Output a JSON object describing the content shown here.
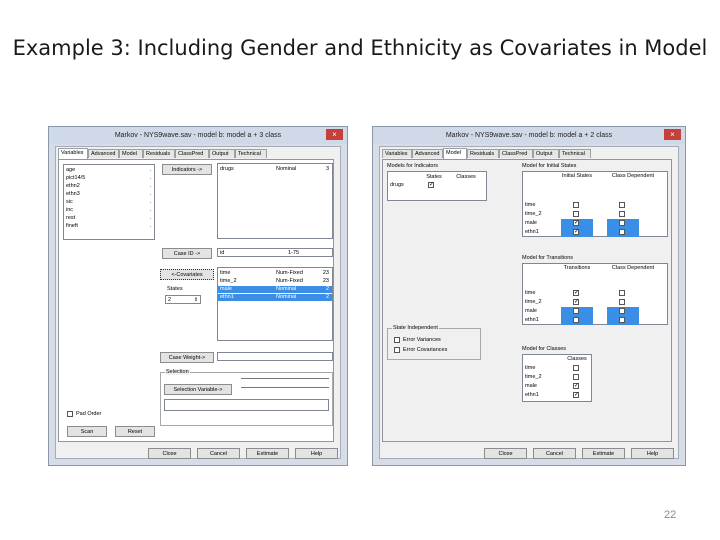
{
  "slide": {
    "title": "Example 3: Including Gender and Ethnicity as Covariates in Model",
    "page_number": "22"
  },
  "left_window": {
    "title": "Markov - NYS9wave.sav - model b: model a + 3 class",
    "tabs": [
      "Variables",
      "Advanced",
      "Model",
      "Residuals",
      "ClassPred",
      "Output",
      "Technical"
    ],
    "variables": [
      "age",
      "pict14/5",
      "ethn2",
      "ethn3",
      "sic",
      "inc",
      "rest",
      "fineft"
    ],
    "variables_dots": [
      ".",
      ".",
      ".",
      ".",
      ".",
      ".",
      ".",
      "."
    ],
    "indicators_button": "Indicators ->",
    "indicators": [
      {
        "name": "drugs",
        "type": "Nominal",
        "count": "3"
      }
    ],
    "case_id_button": "Case ID ->",
    "case_id": {
      "name": "id",
      "value": "1-75"
    },
    "covariates_button": "<-Covariates",
    "covariates": [
      {
        "name": "time",
        "type": "Num-Fixed",
        "count": "23",
        "selected": false
      },
      {
        "name": "time_2",
        "type": "Num-Fixed",
        "count": "23",
        "selected": false
      },
      {
        "name": "male",
        "type": "Nominal",
        "count": "2",
        "selected": true
      },
      {
        "name": "ethn1",
        "type": "Nominal",
        "count": "2",
        "selected": true
      }
    ],
    "states_label": "States",
    "states_value": "2",
    "case_weight_button": "Case Weight->",
    "selection_label": "Selection",
    "selection_variable_button": "Selection Variable->",
    "pad_label": "Pad Order",
    "scan_button": "Scan",
    "reset_button": "Reset",
    "bottom_buttons": [
      "Close",
      "Cancel",
      "Estimate",
      "Help"
    ]
  },
  "right_window": {
    "title": "Markov - NYS9wave.sav - model b: model a + 2 class",
    "tabs": [
      "Variables",
      "Advanced",
      "Model",
      "Residuals",
      "ClassPred",
      "Output",
      "Technical"
    ],
    "models_for_indicators": {
      "label": "Models for Indicators",
      "headers": [
        "States",
        "Classes"
      ],
      "rows": [
        {
          "name": "drugs",
          "states": "✓",
          "classes": ""
        }
      ]
    },
    "initial_states": {
      "label": "Model for Initial States",
      "headers": [
        "Initial States",
        "Class Dependent"
      ],
      "rows": [
        {
          "name": "time",
          "a": false,
          "b": false,
          "blue": false
        },
        {
          "name": "time_2",
          "a": false,
          "b": false,
          "blue": false
        },
        {
          "name": "male",
          "a": true,
          "b": false,
          "blue": true
        },
        {
          "name": "ethn1",
          "a": true,
          "b": false,
          "blue": true
        }
      ]
    },
    "transitions": {
      "label": "Model for Transitions",
      "headers": [
        "Transitions",
        "Class Dependent"
      ],
      "rows": [
        {
          "name": "time",
          "a": true,
          "b": false,
          "blue": false
        },
        {
          "name": "time_2",
          "a": true,
          "b": false,
          "blue": false
        },
        {
          "name": "male",
          "a": false,
          "b": false,
          "blue": true
        },
        {
          "name": "ethn1",
          "a": false,
          "b": false,
          "blue": true
        }
      ]
    },
    "classes": {
      "label": "Model for Classes",
      "headers": [
        "Classes"
      ],
      "rows": [
        {
          "name": "time",
          "a": false
        },
        {
          "name": "time_2",
          "a": false
        },
        {
          "name": "male",
          "a": true
        },
        {
          "name": "ethn1",
          "a": true
        }
      ]
    },
    "state_independent": {
      "label": "State Independent",
      "options": [
        "Error Variances",
        "Error Covariances"
      ]
    },
    "bottom_buttons": [
      "Close",
      "Cancel",
      "Estimate",
      "Help"
    ]
  },
  "colors": {
    "selection": "#3a8ee6",
    "close": "#c6403a",
    "window_frame": "#d7dde6"
  }
}
